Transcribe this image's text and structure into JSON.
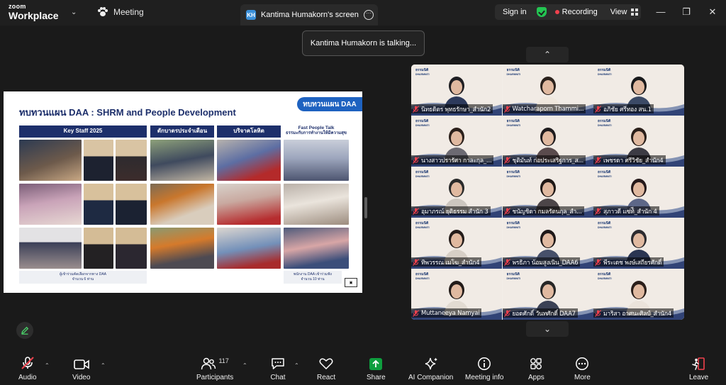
{
  "app": {
    "logo_line1": "zoom",
    "logo_line2": "Workplace",
    "meeting_tab_label": "Meeting",
    "screen_tab_badge": "KH",
    "screen_tab_label": "Kantima Humakorn's screen",
    "sign_in": "Sign in",
    "recording": "Recording",
    "view": "View",
    "colors": {
      "accent_green": "#23c552",
      "record_red": "#f0414d",
      "share_green": "#0e9e3e"
    }
  },
  "toast": {
    "text": "Kantima Humakorn is talking..."
  },
  "slide": {
    "title": "ทบทวนแผน DAA : SHRM and People Development",
    "badge": "ทบทวนแผน DAA",
    "columns": [
      {
        "header": "Key Staff 2025"
      },
      {
        "header": "ตักบาตรประจำเดือน"
      },
      {
        "header": "บริจาคโลหิต"
      },
      {
        "header_line1": "Fast People Talk",
        "header_line2": "ธรรมะกับการทำงานให้มีความสุข"
      }
    ],
    "caption_left_line1": "ผู้เข้าร่วมคัดเลือกจากทาง DAA",
    "caption_left_line2": "จำนวน 6 ท่าน",
    "caption_right_line1": "พนักงาน DAA เข้าร่วมฟัง",
    "caption_right_line2": "จำนวน 10 ท่าน"
  },
  "gallery": {
    "brand_line1": "ธรรมนิติ",
    "brand_line2": "DHARMNITI",
    "participants": [
      {
        "name": "นิทธดิตร พุทธรักษา_สำนัก2"
      },
      {
        "name": "Watcharaporn Thammi..."
      },
      {
        "name": "อภิชัย ศรีทอง สน.1"
      },
      {
        "name": "นางสาวปรารัศา กาละกุล_..."
      },
      {
        "name": "ชุติมันท์ ก่อประเสริฐการ_ส..."
      },
      {
        "name": "เพชรดา ศรีวิชัย_สำนัก4"
      },
      {
        "name": "อุมาภรณ์ ยุติธรรม สำนัก 3"
      },
      {
        "name": "ชนัญชิดา กมลรัตนกุล_สำ..."
      },
      {
        "name": "สุภาวดี แซ่ท้ี_สำนัก 4"
      },
      {
        "name": "ทิพวรรณ เมโฆ_สำนัก4"
      },
      {
        "name": "พรธิภา น้อมสูงเนิน_DAA6"
      },
      {
        "name": "พีระเดช พงษ์เสถียรศักดิ์"
      },
      {
        "name": "Muttaneeya Namyai"
      },
      {
        "name": "ยอดศักดิ์ วันทศักดิ์ DAA7"
      },
      {
        "name": "มาริสา อาศนะศิลป์_สำนัก4"
      }
    ]
  },
  "toolbar": {
    "audio": "Audio",
    "video": "Video",
    "participants": "Participants",
    "participants_count": "117",
    "chat": "Chat",
    "react": "React",
    "share": "Share",
    "ai_companion": "AI Companion",
    "meeting_info": "Meeting info",
    "apps": "Apps",
    "more": "More",
    "leave": "Leave"
  }
}
